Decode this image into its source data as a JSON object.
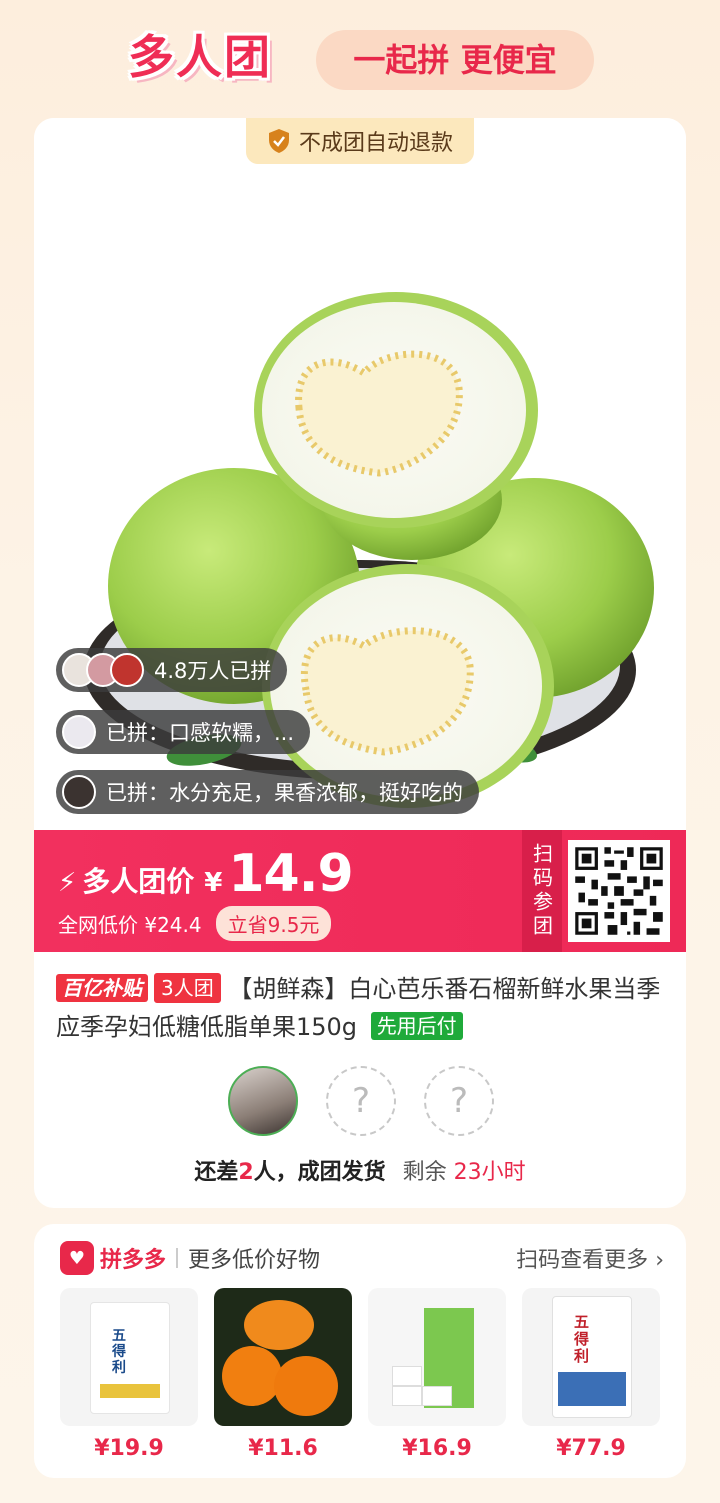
{
  "header": {
    "logo": "多人团",
    "slogan": "一起拼 更便宜"
  },
  "badge": {
    "refund_text": "不成团自动退款",
    "icon": "shield-check-icon"
  },
  "social": {
    "count_text": "4.8万人已拼",
    "review1": "已拼：口感软糯，...",
    "review2": "已拼：水分充足，果香浓郁，挺好吃的"
  },
  "price": {
    "label": "多人团价",
    "currency": "¥",
    "value": "14.9",
    "market_label": "全网低价 ¥24.4",
    "save_text": "立省9.5元",
    "scan_label": "扫码参团"
  },
  "product": {
    "tag_subsidy": "百亿补贴",
    "tag_group": "3人团",
    "title": "【胡鲜森】白心芭乐番石榴新鲜水果当季应季孕妇低糖低脂单果150g",
    "tag_pay": "先用后付"
  },
  "group": {
    "empty_mark": "?",
    "prefix": "还差",
    "missing": "2",
    "suffix": "人，成团发货",
    "remain_label": "剩余",
    "remain_time": "23小时"
  },
  "more": {
    "brand": "拼多多",
    "subtitle": "更多低价好物",
    "scan_more": "扫码查看更多",
    "goods": [
      {
        "price": "¥19.9",
        "label_lines": [
          "五",
          "得",
          "利"
        ]
      },
      {
        "price": "¥11.6"
      },
      {
        "price": "¥16.9"
      },
      {
        "price": "¥77.9",
        "label_lines": [
          "五",
          "得",
          "利"
        ]
      }
    ]
  },
  "colors": {
    "accent": "#ee2957",
    "brand": "#e8284a",
    "green": "#1faa3a"
  }
}
